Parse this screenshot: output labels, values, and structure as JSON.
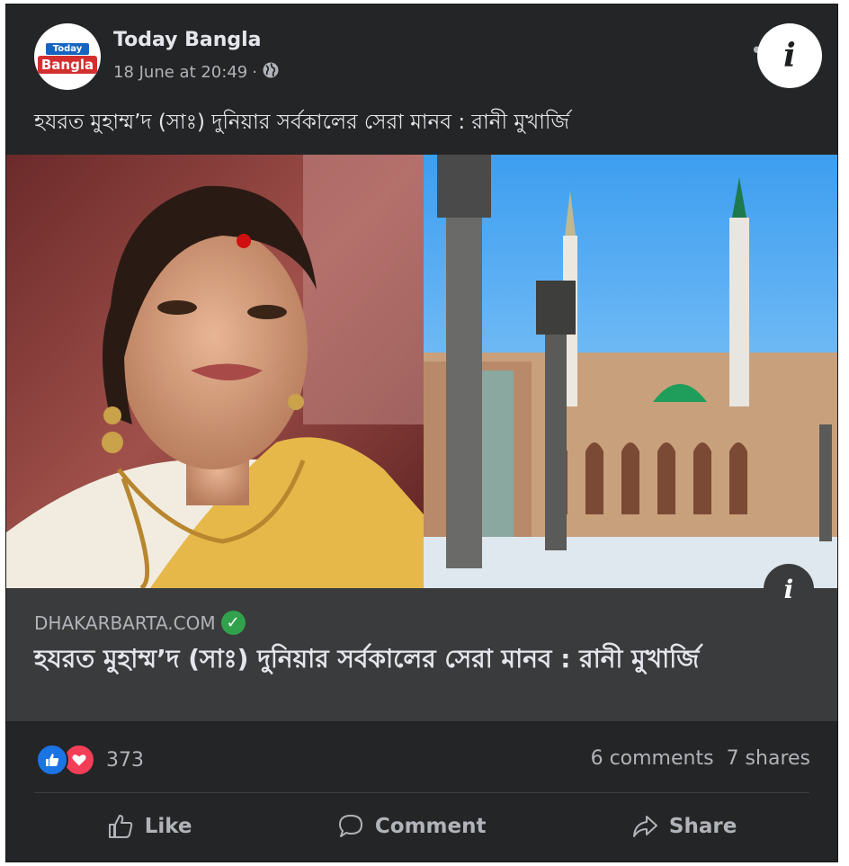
{
  "post": {
    "page_name": "Today Bangla",
    "logo": {
      "top": "Today",
      "bottom": "Bangla"
    },
    "timestamp": "18 June at 20:49",
    "separator": "·",
    "audience_icon": "globe-icon",
    "more_icon": "more-options-icon",
    "more_label": "•••",
    "caption": "হযরত মুহাম্ম’দ (সাঃ) দুনিয়ার সর্বকালের সেরা মানব : রানী মুখার্জি"
  },
  "media": {
    "info_label": "i"
  },
  "link_preview": {
    "domain": "DHAKARBARTA.COM",
    "verified_icon": "check-circle-icon",
    "verified_mark": "✓",
    "title": "হযরত মুহাম্ম’দ (সাঃ) দুনিয়ার সর্বকালের সেরা মানব : রানী মুখার্জি"
  },
  "stats": {
    "reaction_icons": [
      "like-reaction-icon",
      "love-reaction-icon"
    ],
    "reaction_count": "373",
    "comments": "6 comments",
    "shares": "7 shares"
  },
  "actions": {
    "like": "Like",
    "comment": "Comment",
    "share": "Share"
  },
  "colors": {
    "card_bg": "#242526",
    "link_bg": "#3a3b3c",
    "like_blue": "#1b74e4",
    "love_red": "#f33e58",
    "verified_green": "#31a24c"
  }
}
